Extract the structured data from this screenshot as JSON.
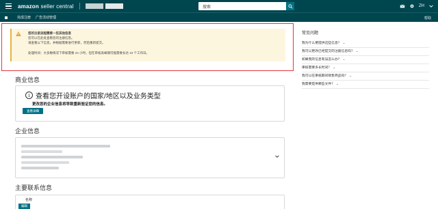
{
  "header": {
    "logo_main": "amazon",
    "logo_sub": "seller central",
    "search_text": "搜索",
    "lang": "ZH",
    "help": "帮助"
  },
  "nav": {
    "item1": "完成注册",
    "item2": "广告活动管理"
  },
  "alert": {
    "lines": [
      "您的注册流程需要一些其他信息",
      "您可以在此处查看您的注册信息。",
      "请查看以下信息，并根据需要进行更新，然后重新提交。",
      "处理时间：大多数情况下审核需要 24 小时，但在审核高峰期可能需要长达 10 个工作日。"
    ]
  },
  "business": {
    "section_title": "商业信息",
    "card_heading": "查看您开设账户的国家/地区以及业务类型",
    "card_sub": "更改您的企业信息将导致重新验证您的信息。",
    "button": "查看详细"
  },
  "company": {
    "section_title": "企业信息"
  },
  "contact": {
    "section_title": "主要联系信息",
    "name_label": "名称",
    "edit_label": "编辑"
  },
  "faq": {
    "title": "常见问题",
    "items": [
      "我为什么要提供这些信息？",
      "我可以更改已经提交的注册信息吗？",
      "如果我的信息有误怎么办？",
      "审核需要多长时间？",
      "我可以在审核期间销售商品吗？",
      "我需要提供哪些文件？"
    ]
  },
  "colors": {
    "header_bg": "#00464f",
    "accent": "#007185",
    "alert_bg": "#fdf6df",
    "alert_border": "#e6b33b",
    "highlight_frame": "#e4343a"
  }
}
